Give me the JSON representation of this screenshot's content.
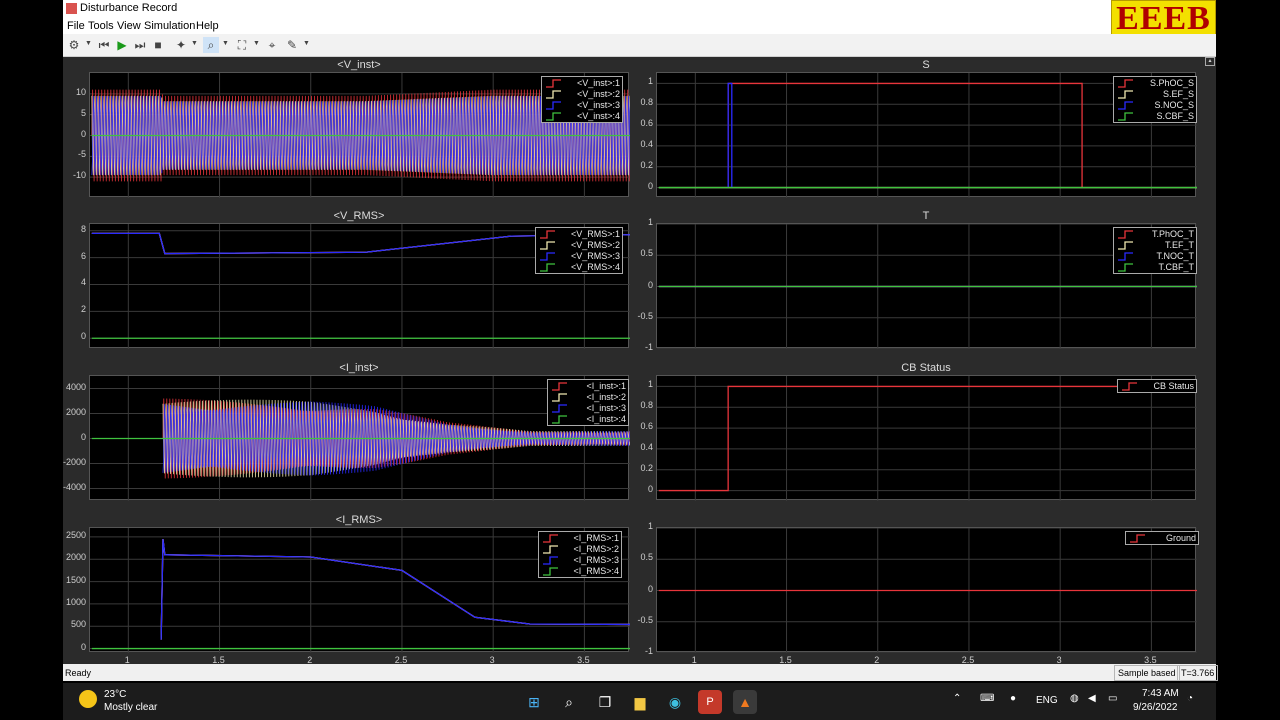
{
  "window": {
    "title": "Disturbance Record",
    "logo_text": "EEEB"
  },
  "menu": [
    "File",
    "Tools",
    "View",
    "Simulation",
    "Help"
  ],
  "toolbar": {
    "icons": [
      "settings-icon",
      "step-back-icon",
      "run-icon",
      "step-forward-icon",
      "stop-icon",
      "highlight-icon",
      "zoom-icon",
      "autoscale-icon",
      "cursor-icon",
      "style-icon"
    ]
  },
  "colors": {
    "ch1": "#e8353b",
    "ch2": "#f0e8b0",
    "ch3": "#2a2aff",
    "ch4": "#3fc33f",
    "axes_bg": "#000000",
    "panel_bg": "#2b2b2b"
  },
  "x_ticks": [
    "1",
    "1.5",
    "2",
    "2.5",
    "3",
    "3.5"
  ],
  "plots": [
    {
      "title": "<V_inst>",
      "yticks": [
        "10",
        "5",
        "0",
        "-5",
        "-10"
      ],
      "legend": [
        "<V_inst>:1",
        "<V_inst>:2",
        "<V_inst>:3",
        "<V_inst>:4"
      ]
    },
    {
      "title": "<V_RMS>",
      "yticks": [
        "8",
        "6",
        "4",
        "2",
        "0"
      ],
      "legend": [
        "<V_RMS>:1",
        "<V_RMS>:2",
        "<V_RMS>:3",
        "<V_RMS>:4"
      ]
    },
    {
      "title": "<I_inst>",
      "yticks": [
        "4000",
        "2000",
        "0",
        "-2000",
        "-4000"
      ],
      "legend": [
        "<I_inst>:1",
        "<I_inst>:2",
        "<I_inst>:3",
        "<I_inst>:4"
      ]
    },
    {
      "title": "<I_RMS>",
      "yticks": [
        "2500",
        "2000",
        "1500",
        "1000",
        "500",
        "0"
      ],
      "legend": [
        "<I_RMS>:1",
        "<I_RMS>:2",
        "<I_RMS>:3",
        "<I_RMS>:4"
      ]
    },
    {
      "title": "S",
      "yticks": [
        "1",
        "0.8",
        "0.6",
        "0.4",
        "0.2",
        "0"
      ],
      "legend": [
        "S.PhOC_S",
        "S.EF_S",
        "S.NOC_S",
        "S.CBF_S"
      ]
    },
    {
      "title": "T",
      "yticks": [
        "1",
        "0.5",
        "0",
        "-0.5",
        "-1"
      ],
      "legend": [
        "T.PhOC_T",
        "T.EF_T",
        "T.NOC_T",
        "T.CBF_T"
      ]
    },
    {
      "title": "CB Status",
      "yticks": [
        "1",
        "0.8",
        "0.6",
        "0.4",
        "0.2",
        "0"
      ],
      "legend": [
        "CB Status"
      ]
    },
    {
      "title": "",
      "yticks": [
        "1",
        "0.5",
        "0",
        "-0.5",
        "-1"
      ],
      "legend": [
        "Ground"
      ]
    }
  ],
  "chart_data": [
    {
      "type": "line",
      "title": "<V_inst>",
      "xlim": [
        0.79,
        3.75
      ],
      "ylim": [
        -15,
        15
      ],
      "series": [
        {
          "name": "<V_inst>:1",
          "x": [
            0.8,
            1.18,
            1.19,
            2.3,
            3.0,
            3.75
          ],
          "y_amplitude": [
            11,
            11,
            9.5,
            9.5,
            11,
            11
          ]
        },
        {
          "name": "<V_inst>:2",
          "x": [
            0.8,
            1.18,
            1.19,
            2.3,
            3.0,
            3.75
          ],
          "y_amplitude": [
            11,
            11,
            9.5,
            9.5,
            11,
            11
          ]
        },
        {
          "name": "<V_inst>:3",
          "x": [
            0.8,
            1.18,
            1.19,
            2.3,
            3.0,
            3.75
          ],
          "y_amplitude": [
            11,
            11,
            9.5,
            9.5,
            11,
            11
          ]
        },
        {
          "name": "<V_inst>:4",
          "x": [
            0.8,
            3.75
          ],
          "y": [
            0,
            0
          ]
        }
      ]
    },
    {
      "type": "line",
      "title": "<V_RMS>",
      "xlim": [
        0.79,
        3.75
      ],
      "ylim": [
        -0.8,
        8.5
      ],
      "series": [
        {
          "name": "<V_RMS>:1",
          "x": [
            0.8,
            1.17,
            1.2,
            2.3,
            3.1,
            3.75
          ],
          "y": [
            7.8,
            7.8,
            6.3,
            6.4,
            7.6,
            7.7
          ]
        },
        {
          "name": "<V_RMS>:2",
          "x": [
            0.8,
            1.17,
            1.2,
            2.3,
            3.1,
            3.75
          ],
          "y": [
            7.8,
            7.8,
            6.3,
            6.4,
            7.6,
            7.7
          ]
        },
        {
          "name": "<V_RMS>:3",
          "x": [
            0.8,
            1.17,
            1.2,
            2.3,
            3.1,
            3.75
          ],
          "y": [
            7.8,
            7.8,
            6.3,
            6.4,
            7.6,
            7.7
          ]
        },
        {
          "name": "<V_RMS>:4",
          "x": [
            0.8,
            3.75
          ],
          "y": [
            0,
            0
          ]
        }
      ]
    },
    {
      "type": "line",
      "title": "<I_inst>",
      "xlim": [
        0.79,
        3.75
      ],
      "ylim": [
        -5000,
        5000
      ],
      "series": [
        {
          "name": "<I_inst>:1",
          "x": [
            1.19,
            2.0,
            2.35,
            2.75,
            3.2,
            3.75
          ],
          "y_amplitude": [
            3200,
            3050,
            2600,
            1300,
            600,
            600
          ]
        },
        {
          "name": "<I_inst>:2",
          "x": [
            1.19,
            2.0,
            2.35,
            2.75,
            3.2,
            3.75
          ],
          "y_amplitude": [
            3200,
            3050,
            2600,
            1300,
            600,
            600
          ]
        },
        {
          "name": "<I_inst>:3",
          "x": [
            1.19,
            2.0,
            2.35,
            2.75,
            3.2,
            3.75
          ],
          "y_amplitude": [
            3200,
            3050,
            2600,
            1300,
            600,
            600
          ]
        },
        {
          "name": "<I_inst>:4",
          "x": [
            0.8,
            3.75
          ],
          "y": [
            0,
            0
          ]
        }
      ]
    },
    {
      "type": "line",
      "title": "<I_RMS>",
      "xlim": [
        0.79,
        3.75
      ],
      "ylim": [
        -100,
        2700
      ],
      "series": [
        {
          "name": "<I_RMS>:1",
          "x": [
            1.18,
            1.19,
            1.2,
            1.21,
            2.0,
            2.5,
            2.9,
            3.2,
            3.75
          ],
          "y": [
            200,
            2450,
            2100,
            2100,
            2050,
            1750,
            700,
            550,
            540
          ]
        },
        {
          "name": "<I_RMS>:2",
          "x": [
            1.18,
            1.19,
            1.2,
            1.21,
            2.0,
            2.5,
            2.9,
            3.2,
            3.75
          ],
          "y": [
            200,
            2450,
            2100,
            2100,
            2050,
            1750,
            700,
            550,
            540
          ]
        },
        {
          "name": "<I_RMS>:3",
          "x": [
            1.18,
            1.19,
            1.2,
            1.21,
            2.0,
            2.5,
            2.9,
            3.2,
            3.75
          ],
          "y": [
            200,
            2450,
            2100,
            2100,
            2050,
            1750,
            700,
            550,
            540
          ]
        },
        {
          "name": "<I_RMS>:4",
          "x": [
            0.8,
            3.75
          ],
          "y": [
            0,
            0
          ]
        }
      ]
    },
    {
      "type": "line",
      "title": "S",
      "xlim": [
        0.79,
        3.75
      ],
      "ylim": [
        -0.1,
        1.1
      ],
      "series": [
        {
          "name": "S.PhOC_S",
          "x": [
            1.18,
            1.18,
            3.12,
            3.12
          ],
          "y": [
            0,
            1,
            1,
            0
          ]
        },
        {
          "name": "S.EF_S",
          "x": [
            0.8,
            3.75
          ],
          "y": [
            0,
            0
          ]
        },
        {
          "name": "S.NOC_S",
          "x": [
            1.18,
            1.18,
            1.2,
            1.2
          ],
          "y": [
            0,
            1,
            1,
            0
          ]
        },
        {
          "name": "S.CBF_S",
          "x": [
            0.8,
            3.75
          ],
          "y": [
            0,
            0
          ]
        }
      ]
    },
    {
      "type": "line",
      "title": "T",
      "xlim": [
        0.79,
        3.75
      ],
      "ylim": [
        -1,
        1
      ],
      "series": [
        {
          "name": "T.PhOC_T",
          "x": [
            0.8,
            3.75
          ],
          "y": [
            0,
            0
          ]
        },
        {
          "name": "T.EF_T",
          "x": [
            0.8,
            3.75
          ],
          "y": [
            0,
            0
          ]
        },
        {
          "name": "T.NOC_T",
          "x": [
            0.8,
            3.75
          ],
          "y": [
            0,
            0
          ]
        },
        {
          "name": "T.CBF_T",
          "x": [
            0.8,
            3.75
          ],
          "y": [
            0,
            0
          ]
        }
      ]
    },
    {
      "type": "line",
      "title": "CB Status",
      "xlim": [
        0.79,
        3.75
      ],
      "ylim": [
        -0.1,
        1.1
      ],
      "series": [
        {
          "name": "CB Status",
          "x": [
            0.8,
            1.18,
            1.18,
            3.75
          ],
          "y": [
            0,
            0,
            1,
            1
          ]
        }
      ]
    },
    {
      "type": "line",
      "title": "",
      "xlim": [
        0.79,
        3.75
      ],
      "ylim": [
        -1,
        1
      ],
      "series": [
        {
          "name": "Ground",
          "x": [
            0.8,
            3.75
          ],
          "y": [
            0,
            0
          ]
        }
      ]
    }
  ],
  "status": {
    "left": "Ready",
    "mode": "Sample based",
    "time": "T=3.766"
  },
  "taskbar": {
    "weather_temp": "23°C",
    "weather_text": "Mostly clear",
    "apps": [
      "windows-start-icon",
      "search-icon",
      "task-view-icon",
      "file-explorer-icon",
      "edge-icon",
      "powerpoint-icon",
      "matlab-icon"
    ],
    "lang": "ENG",
    "time": "7:43 AM",
    "date": "9/26/2022"
  }
}
